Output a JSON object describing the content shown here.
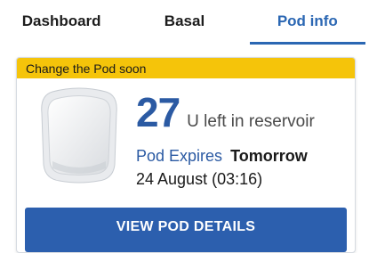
{
  "tabs": [
    {
      "label": "Dashboard",
      "active": false
    },
    {
      "label": "Basal",
      "active": false
    },
    {
      "label": "Pod info",
      "active": true
    }
  ],
  "pod_info": {
    "banner": "Change the Pod soon",
    "reservoir_value": "27",
    "reservoir_text": "U left in reservoir",
    "expires_label": "Pod Expires",
    "expires_value": "Tomorrow",
    "expires_date": "24 August (03:16)",
    "details_button": "VIEW POD DETAILS",
    "pod_icon": "pod-device-icon"
  },
  "colors": {
    "accent": "#2b67b3",
    "banner": "#f5c40a",
    "button": "#2c5fae"
  }
}
